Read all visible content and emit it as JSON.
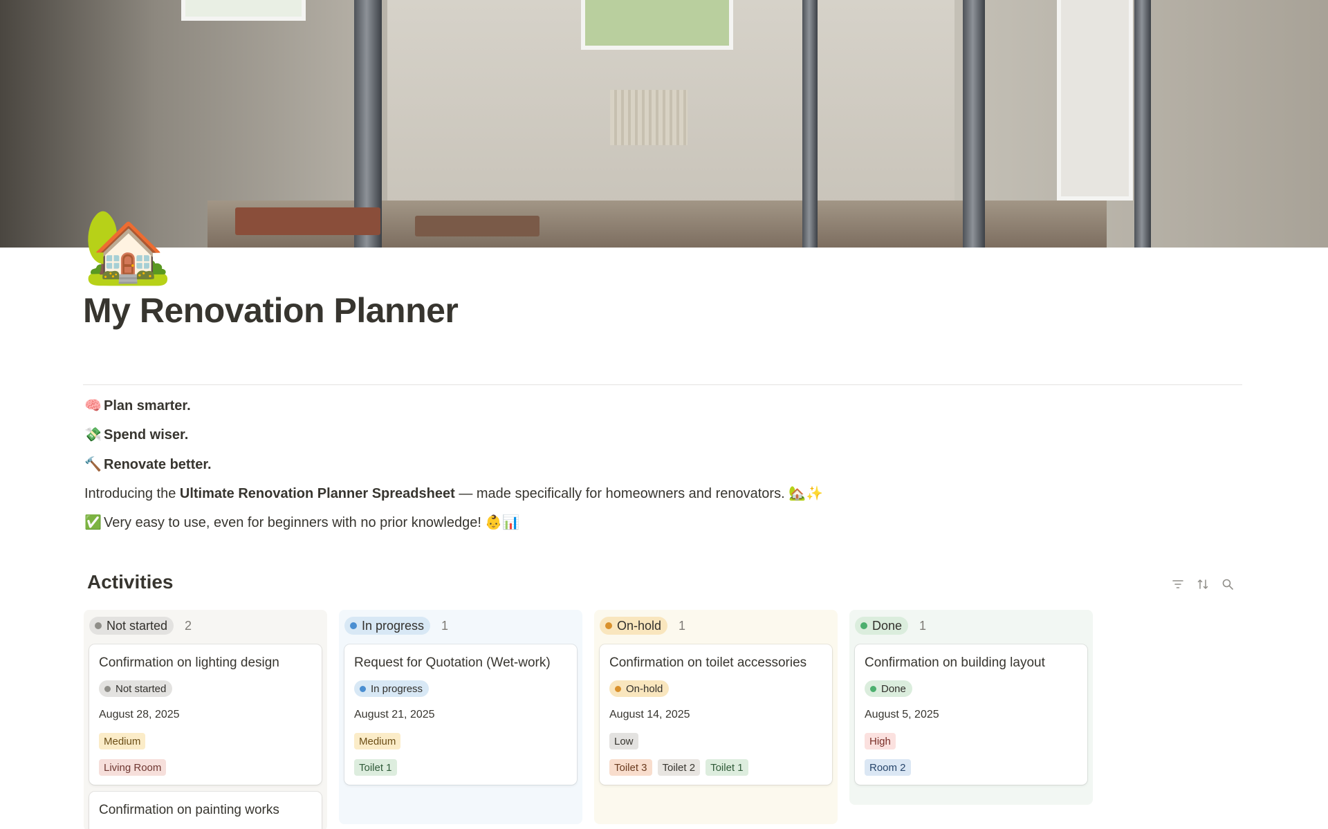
{
  "page": {
    "icon": "house-with-garden-emoji",
    "icon_glyph": "🏡",
    "title": "My Renovation Planner"
  },
  "intro": {
    "line1_emoji": "🧠",
    "line1": "Plan smarter.",
    "line2_emoji": "💸",
    "line2": "Spend wiser.",
    "line3_emoji": "🔨",
    "line3": "Renovate better.",
    "line4_pre": "Introducing the ",
    "line4_bold": "Ultimate Renovation Planner Spreadsheet",
    "line4_post": " — made specifically for homeowners and renovators. 🏡✨",
    "line5_emoji": "✅",
    "line5": "Very easy to use, even for beginners with no prior knowledge! 👶📊"
  },
  "activities": {
    "title": "Activities",
    "toolbar": [
      "filter-icon",
      "sort-icon",
      "search-icon"
    ],
    "columns": [
      {
        "status": "Not started",
        "count": "2",
        "bg": "#f7f6f3",
        "pill_bg": "#e3e2e0",
        "dot": "#8f8e89",
        "cards": [
          {
            "title": "Confirmation on lighting design",
            "status": "Not started",
            "date": "August 28, 2025",
            "priority": "Medium",
            "rooms": [
              "Living Room"
            ]
          },
          {
            "title": "Confirmation on painting works"
          }
        ]
      },
      {
        "status": "In progress",
        "count": "1",
        "bg": "#f3f8fc",
        "pill_bg": "#d8e8f5",
        "dot": "#4a8ed1",
        "cards": [
          {
            "title": "Request for Quotation (Wet-work)",
            "status": "In progress",
            "date": "August 21, 2025",
            "priority": "Medium",
            "rooms": [
              "Toilet 1"
            ]
          }
        ]
      },
      {
        "status": "On-hold",
        "count": "1",
        "bg": "#fcf9ee",
        "pill_bg": "#f9e6be",
        "dot": "#d9912c",
        "cards": [
          {
            "title": "Confirmation on toilet accessories",
            "status": "On-hold",
            "date": "August 14, 2025",
            "priority": "Low",
            "rooms": [
              "Toilet 3",
              "Toilet 2",
              "Toilet 1"
            ]
          }
        ]
      },
      {
        "status": "Done",
        "count": "1",
        "bg": "#f2f7f3",
        "pill_bg": "#dbeddd",
        "dot": "#4caf6e",
        "cards": [
          {
            "title": "Confirmation on building layout",
            "status": "Done",
            "date": "August 5, 2025",
            "priority": "High",
            "rooms": [
              "Room 2"
            ]
          }
        ]
      }
    ]
  },
  "colors": {
    "priority_medium": "#fbecc8",
    "priority_low": "#e3e2e0",
    "priority_high": "#fbe1df",
    "tag_living_room": "#f6dfdb",
    "tag_toilet1": "#ddedde",
    "tag_toilet2": "#e8e5e1",
    "tag_toilet3": "#f8ddcd",
    "tag_room2": "#dbe7f4"
  }
}
